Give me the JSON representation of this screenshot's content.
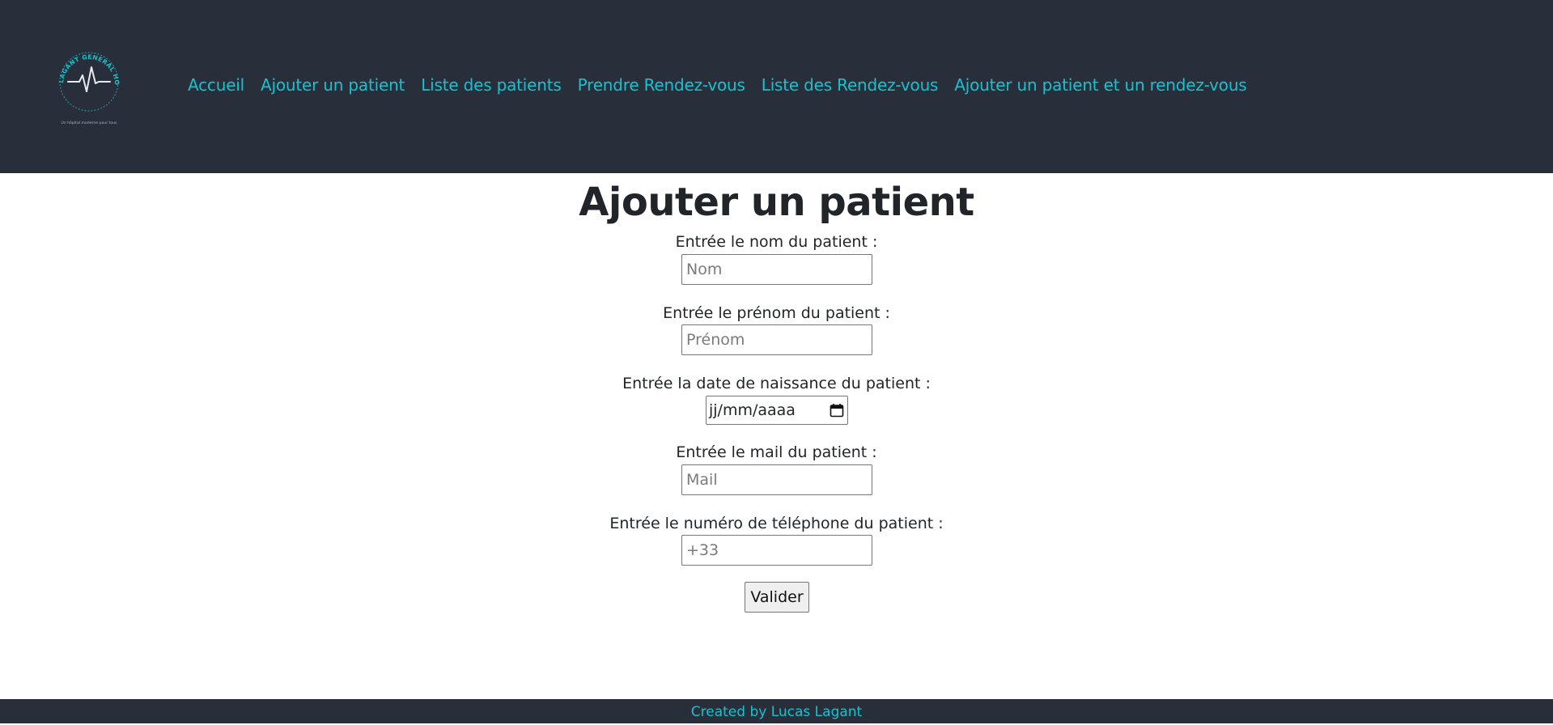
{
  "header": {
    "logo_name": "hospital-logo",
    "logo_text_top": "LAGANT GENERAL HOSPITAL",
    "logo_tagline": "Un hôpital moderne pour tous"
  },
  "nav": {
    "items": [
      {
        "label": "Accueil"
      },
      {
        "label": "Ajouter un patient"
      },
      {
        "label": "Liste des patients"
      },
      {
        "label": "Prendre Rendez-vous"
      },
      {
        "label": "Liste des Rendez-vous"
      },
      {
        "label": "Ajouter un patient et un rendez-vous"
      }
    ]
  },
  "form": {
    "title": "Ajouter un patient",
    "fields": {
      "nom": {
        "label": "Entrée le nom du patient :",
        "placeholder": "Nom",
        "value": ""
      },
      "prenom": {
        "label": "Entrée le prénom du patient :",
        "placeholder": "Prénom",
        "value": ""
      },
      "date": {
        "label": "Entrée la date de naissance du patient :",
        "placeholder": "jj/mm/aaaa",
        "value": ""
      },
      "mail": {
        "label": "Entrée le mail du patient :",
        "placeholder": "Mail",
        "value": ""
      },
      "telephone": {
        "label": "Entrée le numéro de téléphone du patient :",
        "placeholder": "+33",
        "value": ""
      }
    },
    "submit_label": "Valider"
  },
  "footer": {
    "text": "Created by Lucas Lagant"
  },
  "colors": {
    "header_bg": "#282f3b",
    "accent": "#17c1cf",
    "text": "#212529"
  },
  "icons": {
    "calendar": "calendar-icon",
    "heartbeat": "heartbeat-icon"
  }
}
